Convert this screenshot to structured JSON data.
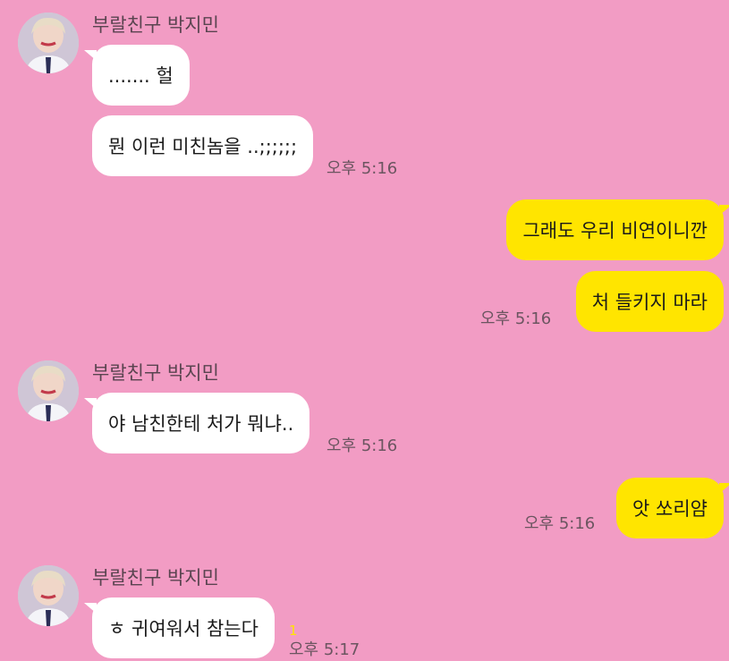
{
  "colors": {
    "background": "#f29cc4",
    "incoming_bubble": "#ffffff",
    "outgoing_bubble": "#ffe500",
    "unread_count": "#ffe500"
  },
  "conversation": {
    "group1": {
      "sender": "부랄친구 박지민",
      "messages": [
        "....... 헐",
        "뭔 이런 미친놈을 ..;;;;;;"
      ],
      "time": "오후 5:16"
    },
    "group2": {
      "messages": [
        "그래도 우리 비연이니깐",
        "처 들키지 마라"
      ],
      "time": "오후 5:16"
    },
    "group3": {
      "sender": "부랄친구 박지민",
      "messages": [
        "야 남친한테 처가 뭐냐.."
      ],
      "time": "오후 5:16"
    },
    "group4": {
      "messages": [
        "앗 쏘리얌"
      ],
      "time": "오후 5:16"
    },
    "group5": {
      "sender": "부랄친구 박지민",
      "messages": [
        "ㅎ 귀여워서 참는다"
      ],
      "unread": "1",
      "time": "오후 5:17"
    }
  }
}
